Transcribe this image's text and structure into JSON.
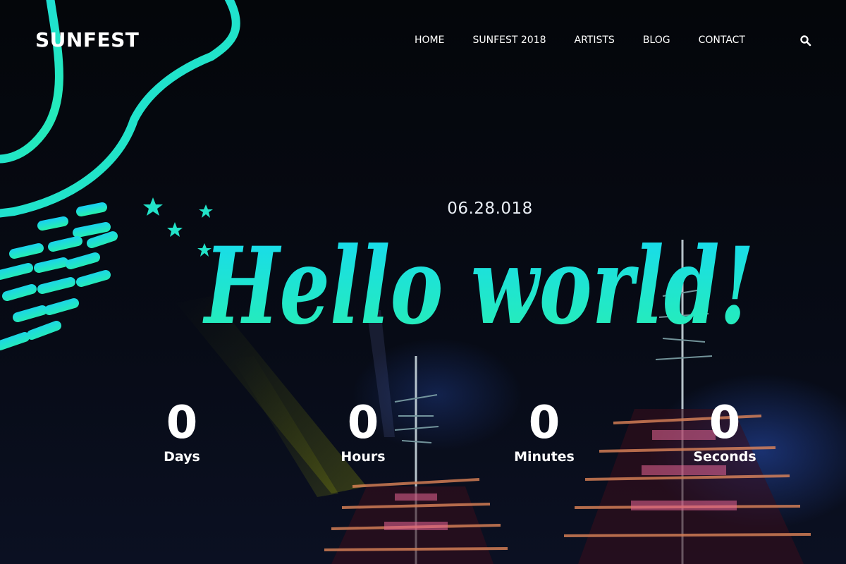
{
  "brand": {
    "name": "SUNFEST"
  },
  "nav": {
    "items": [
      "HOME",
      "SUNFEST 2018",
      "ARTISTS",
      "BLOG",
      "CONTACT"
    ]
  },
  "icons": {
    "search": "search-icon"
  },
  "hero": {
    "date": "06.28.018",
    "title": "Hello world!"
  },
  "countdown": {
    "days": {
      "value": "0",
      "label": "Days"
    },
    "hours": {
      "value": "0",
      "label": "Hours"
    },
    "minutes": {
      "value": "0",
      "label": "Minutes"
    },
    "seconds": {
      "value": "0",
      "label": "Seconds"
    }
  },
  "colors": {
    "accent_cyan": "#1fd8e6",
    "accent_green": "#21e8b5",
    "background": "#05070c"
  }
}
